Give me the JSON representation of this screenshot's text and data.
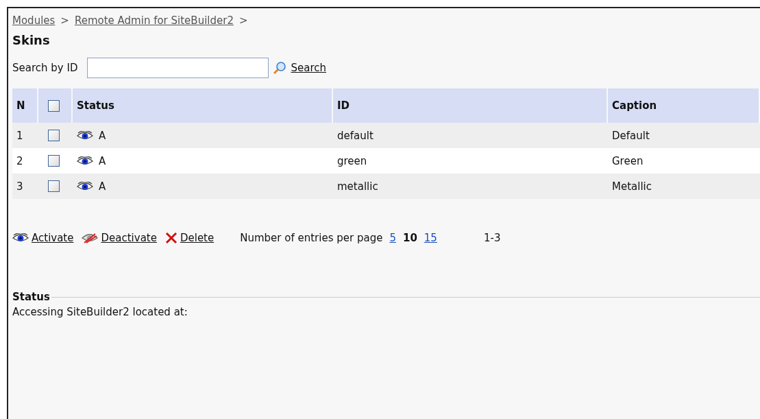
{
  "breadcrumbs": [
    {
      "label": "Modules",
      "separator": ">"
    },
    {
      "label": "Remote Admin for SiteBuilder2",
      "separator": ">"
    }
  ],
  "title": "Skins",
  "search": {
    "label": "Search by ID",
    "button": "Search"
  },
  "table": {
    "columns": [
      "N",
      "Status",
      "ID",
      "Caption"
    ],
    "select_all_checked": false,
    "rows": [
      {
        "n": "1",
        "checked": false,
        "status": "A",
        "id": "default",
        "caption": "Default"
      },
      {
        "n": "2",
        "checked": false,
        "status": "A",
        "id": "green",
        "caption": "Green"
      },
      {
        "n": "3",
        "checked": false,
        "status": "A",
        "id": "metallic",
        "caption": "Metallic"
      }
    ]
  },
  "actions": [
    {
      "kind": "activate",
      "label": "Activate"
    },
    {
      "kind": "deactivate",
      "label": "Deactivate"
    },
    {
      "kind": "delete",
      "label": "Delete"
    }
  ],
  "paging": {
    "label": "Number of entries per page",
    "options": [
      {
        "label": "5",
        "selected": false
      },
      {
        "label": "10",
        "selected": true
      },
      {
        "label": "15",
        "selected": false
      }
    ],
    "range": "1-3"
  },
  "status": {
    "heading": "Status",
    "text": "Accessing SiteBuilder2 located at:"
  }
}
